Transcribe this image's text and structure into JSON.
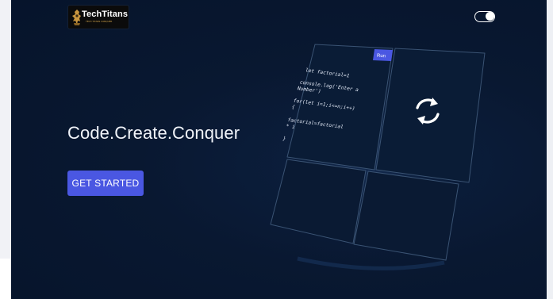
{
  "brand": {
    "name": "TechTitans",
    "tagline": "TECH TITANS CONQUER"
  },
  "header": {
    "theme_toggle": {
      "state": "on"
    }
  },
  "hero": {
    "headline": "Code.Create.Conquer",
    "cta_label": "GET STARTED"
  },
  "editor_mockup": {
    "run_label": "Run",
    "code_lines": [
      "let factorial=1",
      "",
      "console.log('Enter a",
      "Number')",
      "",
      "for(let i=1;i<=n;i++)",
      "{",
      "",
      "factorial=factorial",
      "* i",
      "}"
    ],
    "output_icon": "refresh-icon"
  },
  "colors": {
    "background": "#06142b",
    "accent": "#4a57e2",
    "panel_border": "#3a5373",
    "text": "#f1f4fa"
  }
}
